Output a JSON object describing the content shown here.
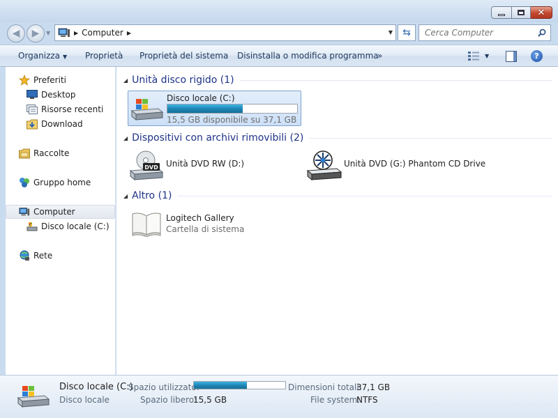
{
  "window": {
    "address": {
      "location": "Computer"
    },
    "search": {
      "placeholder": "Cerca Computer"
    }
  },
  "toolbar": {
    "organize": "Organizza",
    "properties": "Proprietà",
    "system_properties": "Proprietà del sistema",
    "uninstall": "Disinstalla o modifica programma",
    "more": "»"
  },
  "sidebar": {
    "favorites": "Preferiti",
    "desktop": "Desktop",
    "recent": "Risorse recenti",
    "download": "Download",
    "libraries": "Raccolte",
    "homegroup": "Gruppo home",
    "computer": "Computer",
    "local_disk": "Disco locale (C:)",
    "network": "Rete"
  },
  "groups": {
    "hard_disks": {
      "title": "Unità disco rigido (1)",
      "items": [
        {
          "name": "Disco locale (C:)",
          "free_text": "15,5 GB disponibile su 37,1 GB",
          "used_fraction": 0.58
        }
      ]
    },
    "removable": {
      "title": "Dispositivi con archivi rimovibili (2)",
      "items": [
        {
          "name": "Unità DVD RW (D:)",
          "badge": "DVD"
        },
        {
          "name": "Unità DVD (G:) Phantom CD Drive"
        }
      ]
    },
    "other": {
      "title": "Altro (1)",
      "items": [
        {
          "name": "Logitech Gallery",
          "type": "Cartella di sistema"
        }
      ]
    }
  },
  "details": {
    "name": "Disco locale (C:)",
    "type": "Disco locale",
    "used_label": "Spazio utilizzato:",
    "used_fraction": 0.58,
    "free_label": "Spazio libero:",
    "free_value": "15,5 GB",
    "total_label": "Dimensioni totali:",
    "total_value": "37,1 GB",
    "fs_label": "File system:",
    "fs_value": "NTFS"
  },
  "colors": {
    "group_title": "#1e3287",
    "progress": "#1f86b6",
    "selection": "#cde0f7"
  }
}
